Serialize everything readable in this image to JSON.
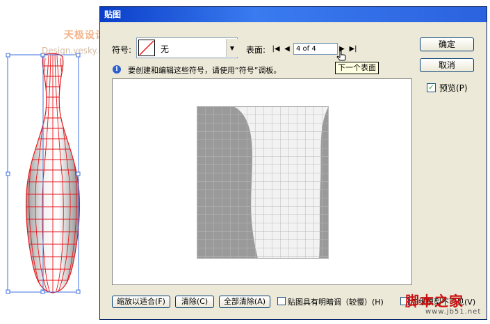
{
  "watermarks": {
    "top_cn": "天极设计在线",
    "top_en": "Design.yesky.com",
    "bottom_cn": "脚本之家",
    "bottom_en": "www.jb51.net"
  },
  "dialog": {
    "title": "贴图",
    "symbol_label": "符号:",
    "symbol_value": "无",
    "surface_label": "表面:",
    "surface_value": "4 of 4",
    "next_tooltip": "下一个表面",
    "info_text": "要创建和编辑这些符号，请使用“符号”调板。",
    "ok_label": "确定",
    "cancel_label": "取消",
    "preview_label": "预览(P)",
    "preview_checked": true,
    "scale_to_fit_label": "缩放以适合(F)",
    "clear_label": "清除(C)",
    "clear_all_label": "全部清除(A)",
    "shade_artwork_label": "贴图具有明暗调（较慢）(H)",
    "invisible_geometry_label": "三维模型不可见(V)"
  },
  "colors": {
    "title_bar": "#0a3ec8",
    "dialog_bg": "#ece9d8",
    "mesh_red": "#e8161b",
    "surface_gray": "#9a9a9a",
    "surface_light": "#f2f2f2"
  },
  "icons": {
    "first": "first-surface-icon",
    "prev": "previous-surface-icon",
    "next": "next-surface-icon",
    "last": "last-surface-icon",
    "info": "info-icon"
  }
}
